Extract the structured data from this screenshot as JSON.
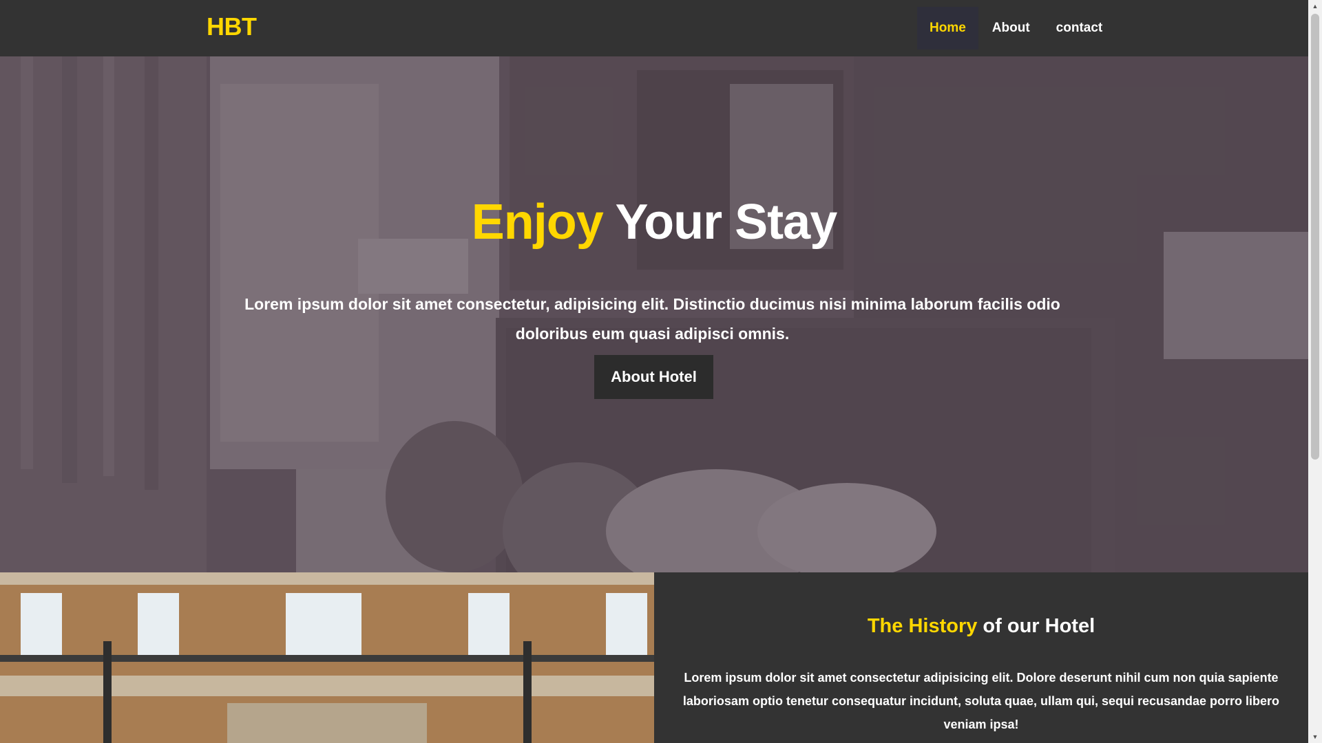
{
  "nav": {
    "brand": "HBT",
    "links": [
      {
        "label": "Home",
        "active": true
      },
      {
        "label": "About",
        "active": false
      },
      {
        "label": "contact",
        "active": false
      }
    ]
  },
  "hero": {
    "title_accent": "Enjoy",
    "title_rest": " Your Stay",
    "text": "Lorem ipsum dolor sit amet consectetur, adipisicing elit. Distinctio ducimus nisi minima laborum facilis odio doloribus eum quasi adipisci omnis.",
    "button_label": "About Hotel"
  },
  "history": {
    "title_accent": "The History",
    "title_rest": " of our Hotel",
    "text": "Lorem ipsum dolor sit amet consectetur adipisicing elit. Dolore deserunt nihil cum non quia sapiente laboriosam optio tenetur consequatur incidunt, soluta quae, ullam qui, sequi recusandae porro libero veniam ipsa!"
  },
  "colors": {
    "accent": "#ffd700",
    "navbar": "#333333",
    "active_nav_bg": "#2f2f3b",
    "button_bg": "#2c2c2c"
  },
  "icons": {
    "scroll_up": "scroll-up-arrow-icon",
    "scroll_down": "scroll-down-arrow-icon"
  }
}
